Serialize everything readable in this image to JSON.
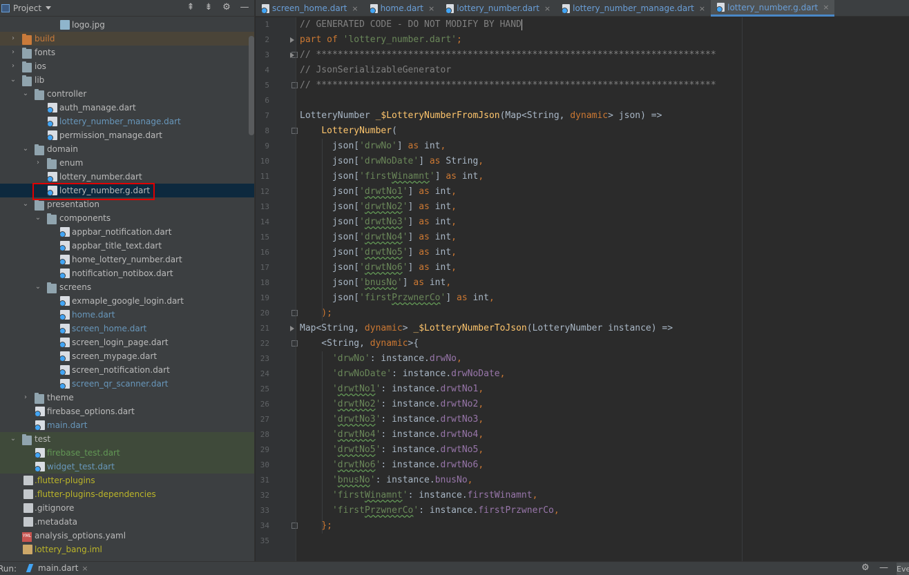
{
  "project_panel": {
    "title": "Project",
    "tools": {
      "collapse_all": "⇞",
      "expand_all": "⇟",
      "settings": "⚙",
      "hide": "—"
    },
    "tree": [
      {
        "label": "logo.jpg",
        "indent": 4,
        "icon": "image-file-icon",
        "color": "default",
        "arrow": ""
      },
      {
        "label": "build",
        "indent": 1,
        "icon": "folder-icon",
        "color": "orange",
        "arrow": "›",
        "style": "excluded"
      },
      {
        "label": "fonts",
        "indent": 1,
        "icon": "folder-icon",
        "color": "default",
        "arrow": "›"
      },
      {
        "label": "ios",
        "indent": 1,
        "icon": "folder-icon",
        "color": "default",
        "arrow": "›"
      },
      {
        "label": "lib",
        "indent": 1,
        "icon": "folder-icon",
        "color": "default",
        "arrow": "⌄"
      },
      {
        "label": "controller",
        "indent": 2,
        "icon": "folder-icon",
        "color": "default",
        "arrow": "⌄"
      },
      {
        "label": "auth_manage.dart",
        "indent": 3,
        "icon": "dart-file-icon",
        "color": "default",
        "arrow": ""
      },
      {
        "label": "lottery_number_manage.dart",
        "indent": 3,
        "icon": "dart-file-icon",
        "color": "blue",
        "arrow": ""
      },
      {
        "label": "permission_manage.dart",
        "indent": 3,
        "icon": "dart-file-icon",
        "color": "default",
        "arrow": ""
      },
      {
        "label": "domain",
        "indent": 2,
        "icon": "folder-icon",
        "color": "default",
        "arrow": "⌄"
      },
      {
        "label": "enum",
        "indent": 3,
        "icon": "folder-icon",
        "color": "default",
        "arrow": "›"
      },
      {
        "label": "lottery_number.dart",
        "indent": 3,
        "icon": "dart-file-icon",
        "color": "default",
        "arrow": ""
      },
      {
        "label": "lottery_number.g.dart",
        "indent": 3,
        "icon": "dart-file-icon",
        "color": "default",
        "arrow": "",
        "style": "selected"
      },
      {
        "label": "presentation",
        "indent": 2,
        "icon": "folder-icon",
        "color": "default",
        "arrow": "⌄"
      },
      {
        "label": "components",
        "indent": 3,
        "icon": "folder-icon",
        "color": "default",
        "arrow": "⌄"
      },
      {
        "label": "appbar_notification.dart",
        "indent": 4,
        "icon": "dart-file-icon",
        "color": "default",
        "arrow": ""
      },
      {
        "label": "appbar_title_text.dart",
        "indent": 4,
        "icon": "dart-file-icon",
        "color": "default",
        "arrow": ""
      },
      {
        "label": "home_lottery_number.dart",
        "indent": 4,
        "icon": "dart-file-icon",
        "color": "default",
        "arrow": ""
      },
      {
        "label": "notification_notibox.dart",
        "indent": 4,
        "icon": "dart-file-icon",
        "color": "default",
        "arrow": ""
      },
      {
        "label": "screens",
        "indent": 3,
        "icon": "folder-icon",
        "color": "default",
        "arrow": "⌄"
      },
      {
        "label": "exmaple_google_login.dart",
        "indent": 4,
        "icon": "dart-file-icon",
        "color": "default",
        "arrow": ""
      },
      {
        "label": "home.dart",
        "indent": 4,
        "icon": "dart-file-icon",
        "color": "blue",
        "arrow": ""
      },
      {
        "label": "screen_home.dart",
        "indent": 4,
        "icon": "dart-file-icon",
        "color": "blue",
        "arrow": ""
      },
      {
        "label": "screen_login_page.dart",
        "indent": 4,
        "icon": "dart-file-icon",
        "color": "default",
        "arrow": ""
      },
      {
        "label": "screen_mypage.dart",
        "indent": 4,
        "icon": "dart-file-icon",
        "color": "default",
        "arrow": ""
      },
      {
        "label": "screen_notification.dart",
        "indent": 4,
        "icon": "dart-file-icon",
        "color": "default",
        "arrow": ""
      },
      {
        "label": "screen_qr_scanner.dart",
        "indent": 4,
        "icon": "dart-file-icon",
        "color": "blue",
        "arrow": ""
      },
      {
        "label": "theme",
        "indent": 2,
        "icon": "folder-icon",
        "color": "default",
        "arrow": "›"
      },
      {
        "label": "firebase_options.dart",
        "indent": 2,
        "icon": "dart-file-icon",
        "color": "default",
        "arrow": ""
      },
      {
        "label": "main.dart",
        "indent": 2,
        "icon": "dart-file-icon",
        "color": "blue",
        "arrow": ""
      },
      {
        "label": "test",
        "indent": 1,
        "icon": "folder-icon",
        "color": "default",
        "arrow": "⌄",
        "style": "test"
      },
      {
        "label": "firebase_test.dart",
        "indent": 2,
        "icon": "dart-file-icon",
        "color": "green",
        "arrow": "",
        "style": "test"
      },
      {
        "label": "widget_test.dart",
        "indent": 2,
        "icon": "dart-file-icon",
        "color": "blue",
        "arrow": "",
        "style": "test"
      },
      {
        "label": ".flutter-plugins",
        "indent": 1,
        "icon": "plain-file-icon",
        "color": "yellow",
        "arrow": ""
      },
      {
        "label": ".flutter-plugins-dependencies",
        "indent": 1,
        "icon": "plain-file-icon",
        "color": "yellow",
        "arrow": ""
      },
      {
        "label": ".gitignore",
        "indent": 1,
        "icon": "plain-file-icon",
        "color": "default",
        "arrow": ""
      },
      {
        "label": ".metadata",
        "indent": 1,
        "icon": "plain-file-icon",
        "color": "default",
        "arrow": ""
      },
      {
        "label": "analysis_options.yaml",
        "indent": 1,
        "icon": "yaml-file-icon",
        "color": "default",
        "arrow": ""
      },
      {
        "label": "lottery_bang.iml",
        "indent": 1,
        "icon": "iml-file-icon",
        "color": "yellow",
        "arrow": ""
      }
    ]
  },
  "tabs": [
    {
      "label": "screen_home.dart",
      "active": false
    },
    {
      "label": "home.dart",
      "active": false
    },
    {
      "label": "lottery_number.dart",
      "active": false
    },
    {
      "label": "lottery_number_manage.dart",
      "active": false
    },
    {
      "label": "lottery_number.g.dart",
      "active": true
    }
  ],
  "tab_close_glyph": "×",
  "editor": {
    "line_numbers": [
      "1",
      "2",
      "3",
      "4",
      "5",
      "6",
      "7",
      "8",
      "9",
      "10",
      "11",
      "12",
      "13",
      "14",
      "15",
      "16",
      "17",
      "18",
      "19",
      "20",
      "21",
      "22",
      "23",
      "24",
      "25",
      "26",
      "27",
      "28",
      "29",
      "30",
      "31",
      "32",
      "33",
      "34",
      "35"
    ],
    "lines": [
      [
        [
          "com",
          "// GENERATED CODE - DO NOT MODIFY BY HAND"
        ],
        [
          "cursor",
          ""
        ]
      ],
      [
        [
          "kw",
          "part of "
        ],
        [
          "str",
          "'lottery_number.dart'"
        ],
        [
          "kw",
          ";"
        ]
      ],
      [
        [
          "com",
          "// **************************************************************************"
        ]
      ],
      [
        [
          "com",
          "// JsonSerializableGenerator"
        ]
      ],
      [
        [
          "com",
          "// **************************************************************************"
        ]
      ],
      [],
      [
        [
          "",
          "LotteryNumber "
        ],
        [
          "fn",
          "_$LotteryNumberFromJson"
        ],
        [
          "",
          "(Map<String, "
        ],
        [
          "kw",
          "dynamic"
        ],
        [
          "",
          "> json) =>"
        ]
      ],
      [
        [
          "",
          "    "
        ],
        [
          "fn",
          "LotteryNumber"
        ],
        [
          "",
          "("
        ]
      ],
      [
        [
          "",
          "      json["
        ],
        [
          "str",
          "'drwNo'"
        ],
        [
          "",
          "] "
        ],
        [
          "kw",
          "as "
        ],
        [
          "",
          "int"
        ],
        [
          "kw",
          ","
        ]
      ],
      [
        [
          "",
          "      json["
        ],
        [
          "str",
          "'drwNoDate'"
        ],
        [
          "",
          "] "
        ],
        [
          "kw",
          "as "
        ],
        [
          "",
          "String"
        ],
        [
          "kw",
          ","
        ]
      ],
      [
        [
          "",
          "      json["
        ],
        [
          "str",
          "'first"
        ],
        [
          "strw",
          "Winamnt"
        ],
        [
          "str",
          "'"
        ],
        [
          "",
          "] "
        ],
        [
          "kw",
          "as "
        ],
        [
          "",
          "int"
        ],
        [
          "kw",
          ","
        ]
      ],
      [
        [
          "",
          "      json["
        ],
        [
          "str",
          "'"
        ],
        [
          "strw",
          "drwtNo1"
        ],
        [
          "str",
          "'"
        ],
        [
          "",
          "] "
        ],
        [
          "kw",
          "as "
        ],
        [
          "",
          "int"
        ],
        [
          "kw",
          ","
        ]
      ],
      [
        [
          "",
          "      json["
        ],
        [
          "str",
          "'"
        ],
        [
          "strw",
          "drwtNo2"
        ],
        [
          "str",
          "'"
        ],
        [
          "",
          "] "
        ],
        [
          "kw",
          "as "
        ],
        [
          "",
          "int"
        ],
        [
          "kw",
          ","
        ]
      ],
      [
        [
          "",
          "      json["
        ],
        [
          "str",
          "'"
        ],
        [
          "strw",
          "drwtNo3"
        ],
        [
          "str",
          "'"
        ],
        [
          "",
          "] "
        ],
        [
          "kw",
          "as "
        ],
        [
          "",
          "int"
        ],
        [
          "kw",
          ","
        ]
      ],
      [
        [
          "",
          "      json["
        ],
        [
          "str",
          "'"
        ],
        [
          "strw",
          "drwtNo4"
        ],
        [
          "str",
          "'"
        ],
        [
          "",
          "] "
        ],
        [
          "kw",
          "as "
        ],
        [
          "",
          "int"
        ],
        [
          "kw",
          ","
        ]
      ],
      [
        [
          "",
          "      json["
        ],
        [
          "str",
          "'"
        ],
        [
          "strw",
          "drwtNo5"
        ],
        [
          "str",
          "'"
        ],
        [
          "",
          "] "
        ],
        [
          "kw",
          "as "
        ],
        [
          "",
          "int"
        ],
        [
          "kw",
          ","
        ]
      ],
      [
        [
          "",
          "      json["
        ],
        [
          "str",
          "'"
        ],
        [
          "strw",
          "drwtNo6"
        ],
        [
          "str",
          "'"
        ],
        [
          "",
          "] "
        ],
        [
          "kw",
          "as "
        ],
        [
          "",
          "int"
        ],
        [
          "kw",
          ","
        ]
      ],
      [
        [
          "",
          "      json["
        ],
        [
          "str",
          "'"
        ],
        [
          "strw",
          "bnusNo"
        ],
        [
          "str",
          "'"
        ],
        [
          "",
          "] "
        ],
        [
          "kw",
          "as "
        ],
        [
          "",
          "int"
        ],
        [
          "kw",
          ","
        ]
      ],
      [
        [
          "",
          "      json["
        ],
        [
          "str",
          "'first"
        ],
        [
          "strw",
          "PrzwnerCo"
        ],
        [
          "str",
          "'"
        ],
        [
          "",
          "] "
        ],
        [
          "kw",
          "as "
        ],
        [
          "",
          "int"
        ],
        [
          "kw",
          ","
        ]
      ],
      [
        [
          "",
          "    "
        ],
        [
          "kw",
          ");"
        ]
      ],
      [
        [
          "",
          "Map<String, "
        ],
        [
          "kw",
          "dynamic"
        ],
        [
          "",
          "> "
        ],
        [
          "fn",
          "_$LotteryNumberToJson"
        ],
        [
          "",
          "(LotteryNumber instance) =>"
        ]
      ],
      [
        [
          "",
          "    <String, "
        ],
        [
          "kw",
          "dynamic"
        ],
        [
          "",
          ">{"
        ]
      ],
      [
        [
          "",
          "      "
        ],
        [
          "str",
          "'drwNo'"
        ],
        [
          "",
          ": instance."
        ],
        [
          "fld",
          "drwNo"
        ],
        [
          "kw",
          ","
        ]
      ],
      [
        [
          "",
          "      "
        ],
        [
          "str",
          "'drwNoDate'"
        ],
        [
          "",
          ": instance."
        ],
        [
          "fld",
          "drwNoDate"
        ],
        [
          "kw",
          ","
        ]
      ],
      [
        [
          "",
          "      "
        ],
        [
          "str",
          "'"
        ],
        [
          "strw",
          "drwtNo1"
        ],
        [
          "str",
          "'"
        ],
        [
          "",
          ": instance."
        ],
        [
          "fld",
          "drwtNo1"
        ],
        [
          "kw",
          ","
        ]
      ],
      [
        [
          "",
          "      "
        ],
        [
          "str",
          "'"
        ],
        [
          "strw",
          "drwtNo2"
        ],
        [
          "str",
          "'"
        ],
        [
          "",
          ": instance."
        ],
        [
          "fld",
          "drwtNo2"
        ],
        [
          "kw",
          ","
        ]
      ],
      [
        [
          "",
          "      "
        ],
        [
          "str",
          "'"
        ],
        [
          "strw",
          "drwtNo3"
        ],
        [
          "str",
          "'"
        ],
        [
          "",
          ": instance."
        ],
        [
          "fld",
          "drwtNo3"
        ],
        [
          "kw",
          ","
        ]
      ],
      [
        [
          "",
          "      "
        ],
        [
          "str",
          "'"
        ],
        [
          "strw",
          "drwtNo4"
        ],
        [
          "str",
          "'"
        ],
        [
          "",
          ": instance."
        ],
        [
          "fld",
          "drwtNo4"
        ],
        [
          "kw",
          ","
        ]
      ],
      [
        [
          "",
          "      "
        ],
        [
          "str",
          "'"
        ],
        [
          "strw",
          "drwtNo5"
        ],
        [
          "str",
          "'"
        ],
        [
          "",
          ": instance."
        ],
        [
          "fld",
          "drwtNo5"
        ],
        [
          "kw",
          ","
        ]
      ],
      [
        [
          "",
          "      "
        ],
        [
          "str",
          "'"
        ],
        [
          "strw",
          "drwtNo6"
        ],
        [
          "str",
          "'"
        ],
        [
          "",
          ": instance."
        ],
        [
          "fld",
          "drwtNo6"
        ],
        [
          "kw",
          ","
        ]
      ],
      [
        [
          "",
          "      "
        ],
        [
          "str",
          "'"
        ],
        [
          "strw",
          "bnusNo"
        ],
        [
          "str",
          "'"
        ],
        [
          "",
          ": instance."
        ],
        [
          "fld",
          "bnusNo"
        ],
        [
          "kw",
          ","
        ]
      ],
      [
        [
          "",
          "      "
        ],
        [
          "str",
          "'first"
        ],
        [
          "strw",
          "Winamnt"
        ],
        [
          "str",
          "'"
        ],
        [
          "",
          ": instance."
        ],
        [
          "fld",
          "firstWinamnt"
        ],
        [
          "kw",
          ","
        ]
      ],
      [
        [
          "",
          "      "
        ],
        [
          "str",
          "'first"
        ],
        [
          "strw",
          "PrzwnerCo"
        ],
        [
          "str",
          "'"
        ],
        [
          "",
          ": instance."
        ],
        [
          "fld",
          "firstPrzwnerCo"
        ],
        [
          "kw",
          ","
        ]
      ],
      [
        [
          "",
          "    "
        ],
        [
          "kw",
          "};"
        ]
      ],
      []
    ]
  },
  "bottom_bar": {
    "run_label": "Run:",
    "run_tab": "main.dart",
    "settings": "⚙",
    "minimize": "—",
    "event_log": "Eve"
  }
}
